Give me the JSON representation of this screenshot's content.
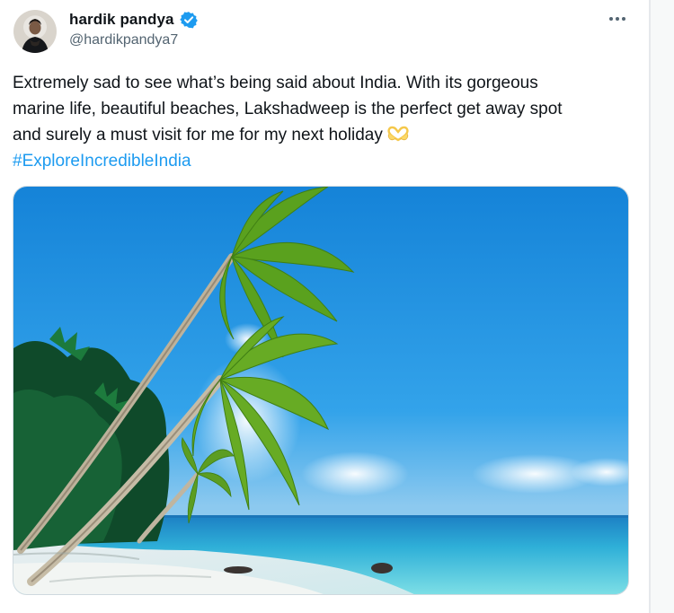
{
  "tweet": {
    "author": {
      "display_name": "hardik pandya",
      "handle": "@hardikpandya7",
      "verified": true,
      "avatar_icon": "profile-photo"
    },
    "more_icon": "more-horizontal-icon",
    "text": "Extremely sad to see what’s being said about India. With its gorgeous\nmarine life, beautiful beaches, Lakshadweep is the perfect get away spot\nand surely a must visit for me for my next holiday",
    "emoji": "heart-hands-emoji",
    "hashtag": "#ExploreIncredibleIndia",
    "media": {
      "type": "photo",
      "subject": "palm trees over a tropical beach"
    }
  },
  "colors": {
    "link": "#1d9bf0",
    "verified_badge": "#1d9bf0",
    "text": "#0f1419",
    "secondary_text": "#536471"
  }
}
